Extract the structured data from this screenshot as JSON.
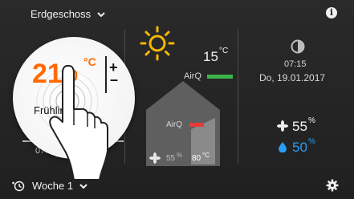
{
  "header": {
    "floor_label": "Erdgeschoss",
    "info_icon": "i"
  },
  "setpoint": {
    "value": "21",
    "decimal": "0",
    "unit": "°C",
    "plus": "+",
    "minus": "–"
  },
  "mode": {
    "label": "Frühling",
    "time": "07:15"
  },
  "outdoor": {
    "temperature": "15",
    "unit": "°C",
    "airq_label": "AirQ",
    "airq_status_color": "#3bb54a",
    "weather_icon": "sun-icon"
  },
  "house": {
    "airq_label": "AirQ",
    "airq_status_color": "#e53b3b",
    "fan_value": "55",
    "fan_unit": "%",
    "room_temp": "80",
    "room_unit": "°C"
  },
  "clock": {
    "time": "07:15",
    "date": "Do, 19.01.2017",
    "icon": "night-mode-icon"
  },
  "stats": {
    "fan_value": "55",
    "fan_unit": "%",
    "humidity_value": "50",
    "humidity_unit": "%",
    "humidity_color": "#2a9df4"
  },
  "footer": {
    "schedule_label": "Woche 1",
    "settings_icon": "gear-icon"
  }
}
